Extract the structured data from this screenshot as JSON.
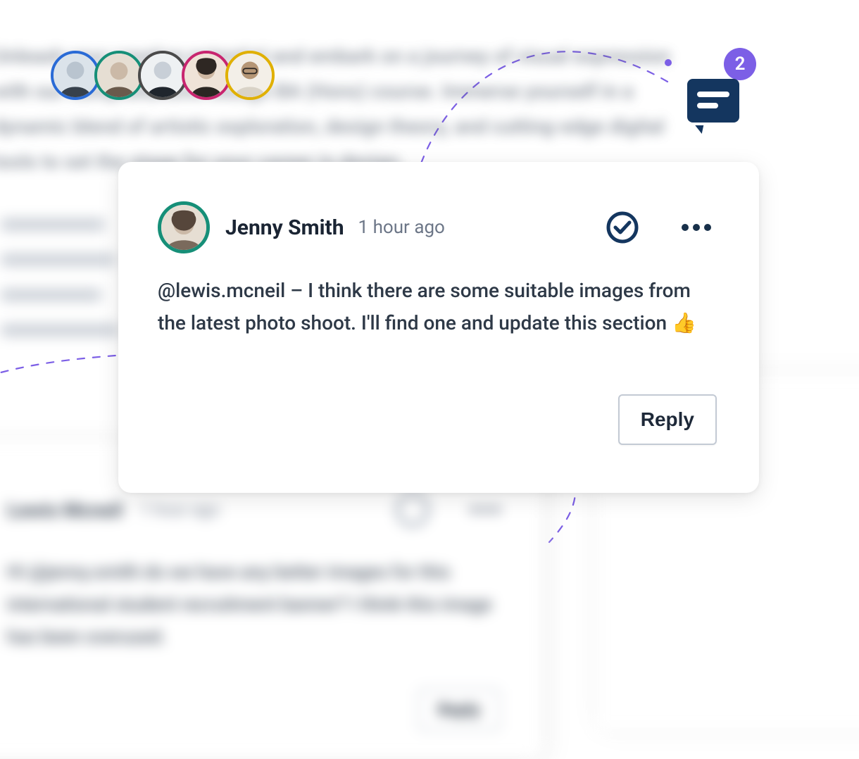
{
  "background": {
    "blurred_text": "Unleash your creative potential and embark on a journey of visual expression with our comprehensive Design BA (Hons) course. Immerse yourself in a dynamic blend of artistic exploration, design theory, and cutting-edge digital tools to set the stage for your career in design.",
    "path_color": "#7c5fe6"
  },
  "avatars": {
    "stack": [
      {
        "border": "#2a6bd6"
      },
      {
        "border": "#168f78"
      },
      {
        "border": "#4a4a4a"
      },
      {
        "border": "#c8256f"
      },
      {
        "border": "#e0b000"
      }
    ]
  },
  "comment_indicator": {
    "count": "2",
    "badge_bg": "#7c5fe6",
    "bubble_bg": "#14365f"
  },
  "comment_primary": {
    "author": "Jenny Smith",
    "timestamp": "1 hour ago",
    "mention": "@lewis.mcneil",
    "body_rest": " – I think there are some suitable images from the latest photo shoot. I'll find one and update this section ",
    "emoji": "👍",
    "reply_label": "Reply"
  },
  "comment_secondary": {
    "author": "Lewis Mcneil",
    "timestamp": "1 hour ago",
    "body": "Hi @jenny.smith do we have any better images for this international student recruitment banner? I think this image has been overused.",
    "reply_label": "Reply"
  }
}
